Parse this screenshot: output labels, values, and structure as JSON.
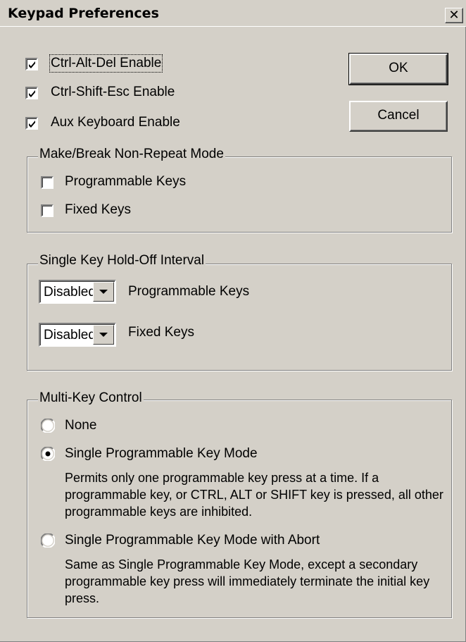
{
  "window": {
    "title": "Keypad Preferences",
    "close_glyph": "✕"
  },
  "options": [
    {
      "label": "Ctrl-Alt-Del Enable",
      "checked": true
    },
    {
      "label": "Ctrl-Shift-Esc Enable",
      "checked": true
    },
    {
      "label": "Aux Keyboard Enable",
      "checked": true
    }
  ],
  "buttons": {
    "ok": "OK",
    "cancel": "Cancel"
  },
  "make_break": {
    "title": "Make/Break Non-Repeat Mode",
    "items": [
      {
        "label": "Programmable Keys",
        "checked": false
      },
      {
        "label": "Fixed Keys",
        "checked": false
      }
    ]
  },
  "holdoff": {
    "title": "Single Key Hold-Off Interval",
    "rows": [
      {
        "value": "Disabled",
        "label": "Programmable Keys"
      },
      {
        "value": "Disabled",
        "label": "Fixed Keys"
      }
    ]
  },
  "multikey": {
    "title": "Multi-Key Control",
    "options": [
      {
        "label": "None",
        "selected": false,
        "description": ""
      },
      {
        "label": "Single Programmable Key Mode",
        "selected": true,
        "description": "Permits only one programmable key press at a time.  If a programmable key, or CTRL, ALT or SHIFT key is pressed, all other programmable keys are inhibited."
      },
      {
        "label": "Single Programmable Key Mode with Abort",
        "selected": false,
        "description": "Same as Single Programmable Key Mode, except a secondary programmable key press will immediately terminate the initial key press."
      }
    ]
  }
}
